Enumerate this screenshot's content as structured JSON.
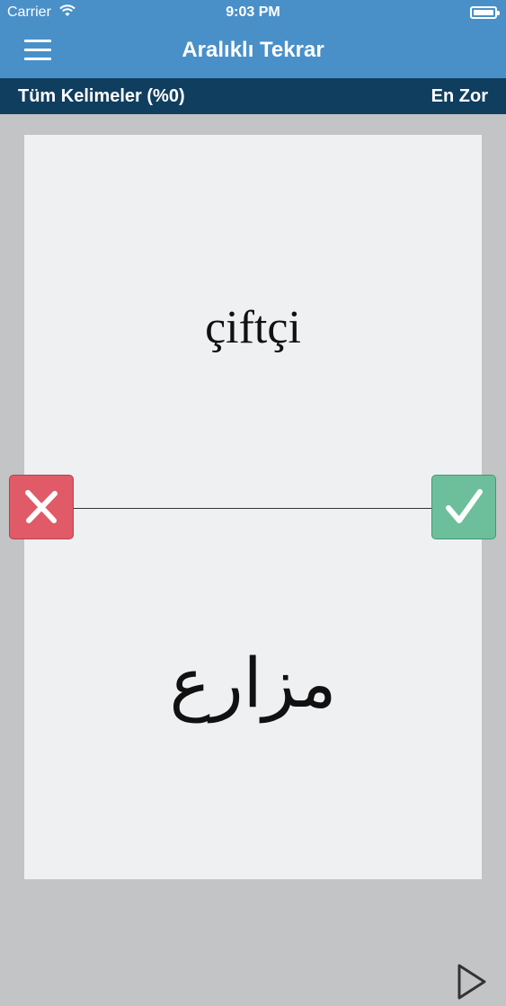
{
  "status_bar": {
    "carrier": "Carrier",
    "time": "9:03 PM"
  },
  "header": {
    "title": "Aralıklı Tekrar"
  },
  "subheader": {
    "deck_label": "Tüm Kelimeler (%0)",
    "mode_label": "En Zor"
  },
  "card": {
    "front_word": "çiftçi",
    "back_word": "مزارع"
  },
  "colors": {
    "header_bg": "#4a90c8",
    "subheader_bg": "#103e5f",
    "wrong_button": "#e05a68",
    "right_button": "#6cbf9a"
  },
  "icons": {
    "menu": "hamburger-menu-icon",
    "wrong": "close-icon",
    "right": "checkmark-icon",
    "play": "play-icon"
  }
}
